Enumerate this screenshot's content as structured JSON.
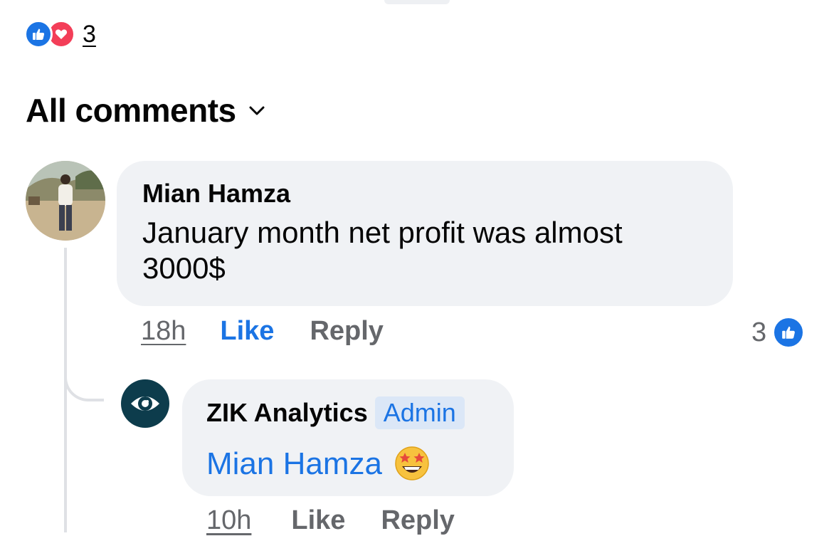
{
  "post": {
    "reaction_icons": [
      "like-icon",
      "love-icon"
    ],
    "reaction_count": "3"
  },
  "comments_header": {
    "sort_label": "All comments",
    "sort_icon": "chevron-down-icon"
  },
  "comments": [
    {
      "author": "Mian Hamza",
      "text": "January month net profit  was almost 3000$",
      "time": "18h",
      "like_label": "Like",
      "reply_label": "Reply",
      "like_count": "3",
      "replies": [
        {
          "author": "ZIK Analytics",
          "badge": "Admin",
          "mention": "Mian Hamza",
          "emoji": "star-struck-emoji",
          "time": "10h",
          "like_label": "Like",
          "reply_label": "Reply"
        }
      ]
    }
  ],
  "colors": {
    "accent": "#1b74e4",
    "love": "#f33e58",
    "bubble": "#f0f2f5",
    "secondary_text": "#65676b",
    "brand_dark": "#0d3c4c"
  }
}
